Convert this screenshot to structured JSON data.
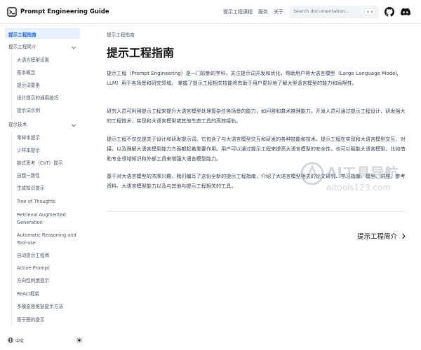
{
  "header": {
    "title": "Prompt Engineering Guide",
    "nav": [
      "提示工程课程",
      "服务",
      "关于"
    ],
    "search_placeholder": "Search documentation...",
    "search_shortcut": "⌘ K"
  },
  "sidebar": {
    "active_label": "提示工程指南",
    "sections": [
      {
        "label": "提示工程简介",
        "items": [
          "大语言模型设置",
          "基本概念",
          "提示词要素",
          "设计提示的通用技巧",
          "提示词示例"
        ]
      },
      {
        "label": "提示技术",
        "items": [
          "零样本提示",
          "少样本提示",
          "链式思考（CoT）提示",
          "自我一致性",
          "生成知识提示",
          "Tree of Thoughts",
          "Retrieval Augmented Generation",
          "Automatic Reasoning and Tool-use",
          "自动提示工程师",
          "Active-Prompt",
          "方向性刺激提示",
          "ReAct框架",
          "多模态思维链提示方法",
          "基于图的提示"
        ]
      }
    ],
    "language": "中文"
  },
  "main": {
    "breadcrumb": "提示工程指南",
    "title": "提示工程指南",
    "paragraphs": [
      "提示工程（Prompt Engineering）是一门较新的学科，关注提示词开发和优化，帮助用户将大语言模型（Large Language Model, LLM）用于各场景和研究领域。 掌握了提示工程相关技能将有助于用户更好地了解大型语言模型的能力和局限性。",
      "研究人员可利用提示工程来提升大语言模型处理复杂任务场景的能力，如问答和算术推理能力。开发人员可通过提示工程设计、研发强大的工程技术，实现和大语言模型或其他生态工具的高效接轨。",
      "提示工程不仅仅是关于设计和研发提示词。它包含了与大语言模型交互和研发的各种技能和技术。提示工程在实现和大语言模型交互、对接，以及理解大语言模型能力方面都起着重要作用。用户可以通过提示工程来提高大语言模型的安全性，也可以赋能大语言模型，比如借助专业领域知识和外部工具来增强大语言模型能力。",
      "基于对大语言模型的浓厚兴趣，我们编写了这份全新的提示工程指南，介绍了大语言模型相关的论文研究、学习指南、模型、讲座、参考资料、大语言模型能力以及与其他与提示工程相关的工具。"
    ],
    "next_link": "提示工程简介"
  },
  "watermark": {
    "line1": "AI工具导航",
    "line2": "aitools123.com"
  },
  "colors": {
    "accent": "#1d64d8",
    "active_bg": "#e6f0ff",
    "text": "#374151",
    "muted": "#4b5563"
  }
}
